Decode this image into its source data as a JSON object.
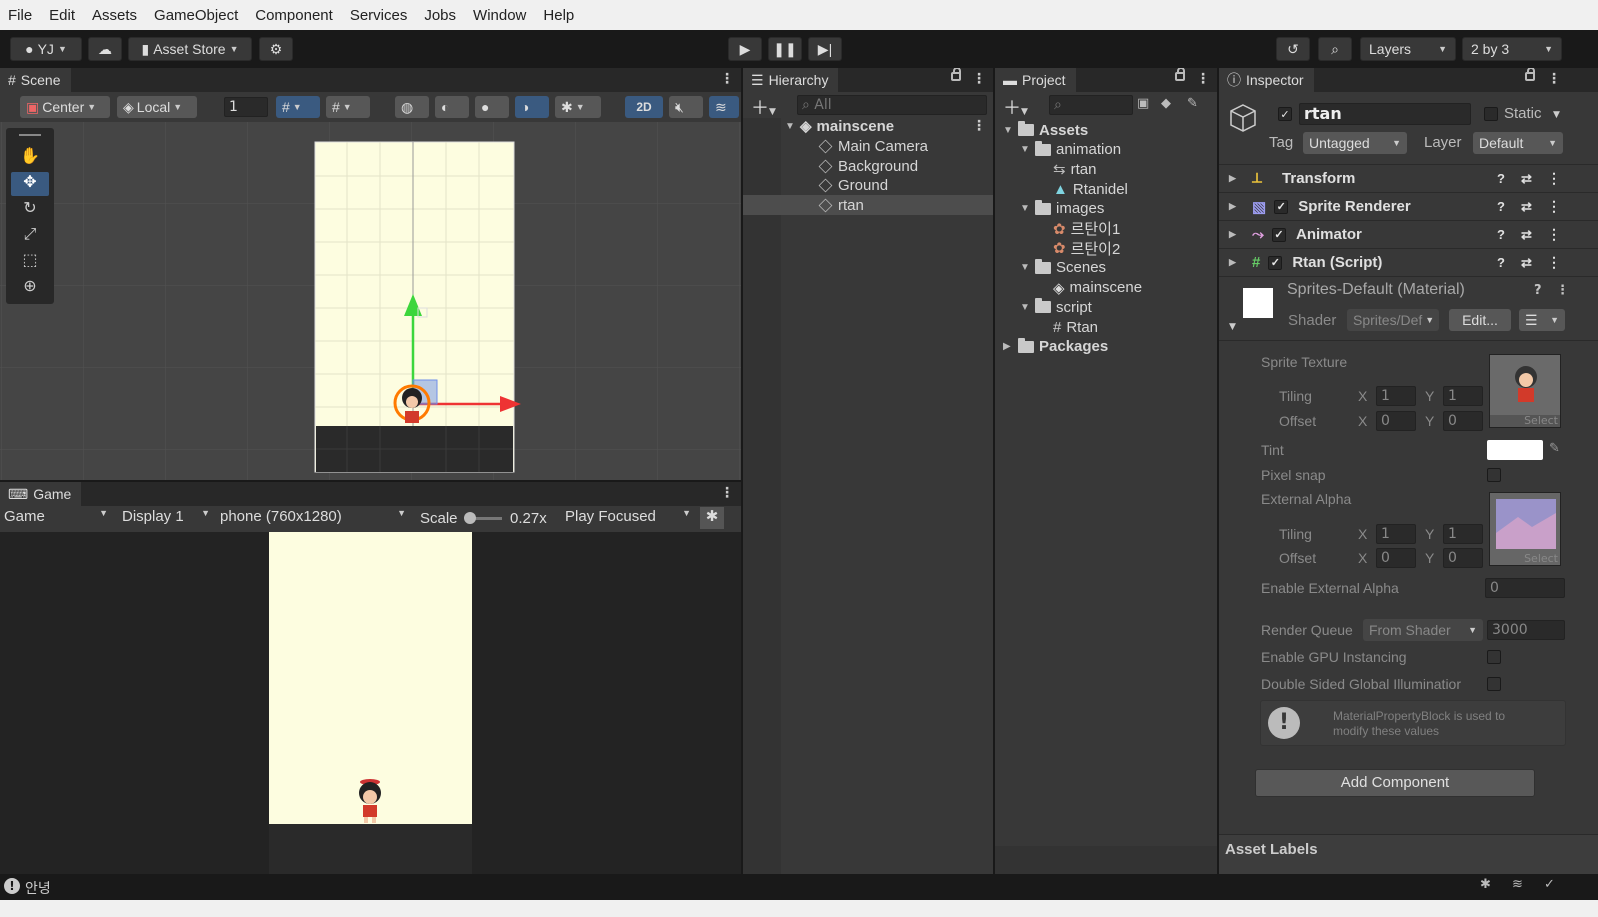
{
  "menu": [
    "File",
    "Edit",
    "Assets",
    "GameObject",
    "Component",
    "Services",
    "Jobs",
    "Window",
    "Help"
  ],
  "toolbar": {
    "account": "YJ",
    "asset_store": "Asset Store",
    "layers": "Layers",
    "layout": "2 by 3"
  },
  "scene": {
    "tab": "Scene",
    "pivot_mode": "Center",
    "pivot_rotation": "Local",
    "grid_value": "1",
    "mode_2d": "2D"
  },
  "game": {
    "tab": "Game",
    "view": "Game",
    "display": "Display 1",
    "resolution": "phone (760x1280)",
    "scale_label": "Scale",
    "scale_value": "0.27x",
    "play_mode": "Play Focused"
  },
  "hierarchy": {
    "tab": "Hierarchy",
    "search_placeholder": "All",
    "scene_name": "mainscene",
    "items": [
      "Main Camera",
      "Background",
      "Ground",
      "rtan"
    ]
  },
  "project": {
    "tab": "Project",
    "tree": [
      {
        "label": "Assets",
        "depth": 0,
        "type": "folder",
        "expanded": true
      },
      {
        "label": "animation",
        "depth": 1,
        "type": "folder",
        "expanded": true
      },
      {
        "label": "rtan",
        "depth": 2,
        "type": "controller"
      },
      {
        "label": "Rtanidel",
        "depth": 2,
        "type": "anim"
      },
      {
        "label": "images",
        "depth": 1,
        "type": "folder",
        "expanded": true
      },
      {
        "label": "르탄이1",
        "depth": 2,
        "type": "sprite"
      },
      {
        "label": "르탄이2",
        "depth": 2,
        "type": "sprite"
      },
      {
        "label": "Scenes",
        "depth": 1,
        "type": "folder",
        "expanded": true
      },
      {
        "label": "mainscene",
        "depth": 2,
        "type": "scene"
      },
      {
        "label": "script",
        "depth": 1,
        "type": "folder",
        "expanded": true
      },
      {
        "label": "Rtan",
        "depth": 2,
        "type": "script"
      },
      {
        "label": "Packages",
        "depth": 0,
        "type": "folder",
        "expanded": false
      }
    ]
  },
  "inspector": {
    "tab": "Inspector",
    "object_name": "rtan",
    "static_label": "Static",
    "tag_label": "Tag",
    "tag_value": "Untagged",
    "layer_label": "Layer",
    "layer_value": "Default",
    "components": [
      "Transform",
      "Sprite Renderer",
      "Animator",
      "Rtan (Script)"
    ],
    "material_name": "Sprites-Default (Material)",
    "shader_label": "Shader",
    "shader_value": "Sprites/Def",
    "edit_button": "Edit...",
    "sprite_texture": "Sprite Texture",
    "tiling": "Tiling",
    "offset": "Offset",
    "x": "X",
    "y": "Y",
    "tiling_x": "1",
    "tiling_y": "1",
    "offset_x": "0",
    "offset_y": "0",
    "select": "Select",
    "tint": "Tint",
    "pixel_snap": "Pixel snap",
    "external_alpha": "External Alpha",
    "enable_external_alpha": "Enable External Alpha",
    "enable_external_alpha_value": "0",
    "render_queue": "Render Queue",
    "render_queue_mode": "From Shader",
    "render_queue_value": "3000",
    "gpu_instancing": "Enable GPU Instancing",
    "double_sided": "Double Sided Global Illuminatior",
    "info_message": "MaterialPropertyBlock is used to modify these values",
    "add_component": "Add Component",
    "asset_labels": "Asset Labels"
  },
  "statusbar": {
    "message": "안녕"
  },
  "colors": {
    "accent": "#3a79bb",
    "sky": "#fdfde0",
    "ground": "#2a2a2a"
  }
}
